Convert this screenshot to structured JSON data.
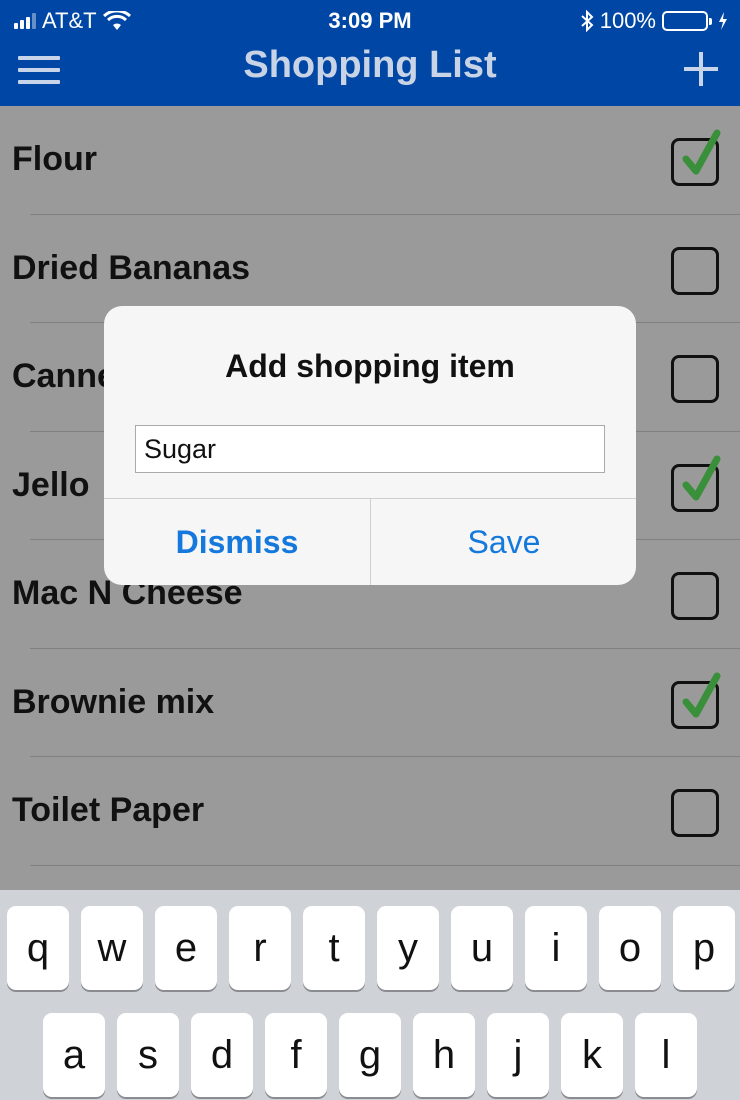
{
  "status_bar": {
    "carrier": "AT&T",
    "time": "3:09 PM",
    "battery_percent": "100%",
    "battery_level": 1.0,
    "icons": [
      "signal-icon",
      "wifi-icon",
      "bluetooth-icon",
      "battery-icon",
      "charging-icon"
    ]
  },
  "nav": {
    "title": "Shopping List",
    "menu_icon": "hamburger-icon",
    "add_icon": "plus-icon"
  },
  "list": {
    "items": [
      {
        "label": "Flour",
        "checked": true
      },
      {
        "label": "Dried Bananas",
        "checked": false
      },
      {
        "label": "Canne",
        "checked": false
      },
      {
        "label": "Jello",
        "checked": true
      },
      {
        "label": "Mac N Cheese",
        "checked": false
      },
      {
        "label": "Brownie mix",
        "checked": true
      },
      {
        "label": "Toilet Paper",
        "checked": false
      }
    ]
  },
  "dialog": {
    "title": "Add shopping item",
    "input_value": "Sugar",
    "dismiss_label": "Dismiss",
    "save_label": "Save"
  },
  "keyboard": {
    "row1": [
      "q",
      "w",
      "e",
      "r",
      "t",
      "y",
      "u",
      "i",
      "o",
      "p"
    ],
    "row2": [
      "a",
      "s",
      "d",
      "f",
      "g",
      "h",
      "j",
      "k",
      "l"
    ]
  },
  "colors": {
    "nav_bar": "#0046a4",
    "check": "#3a8f3a",
    "action_blue": "#1478dc",
    "overlay": "#9a9a9a",
    "battery": "#4cd964"
  }
}
